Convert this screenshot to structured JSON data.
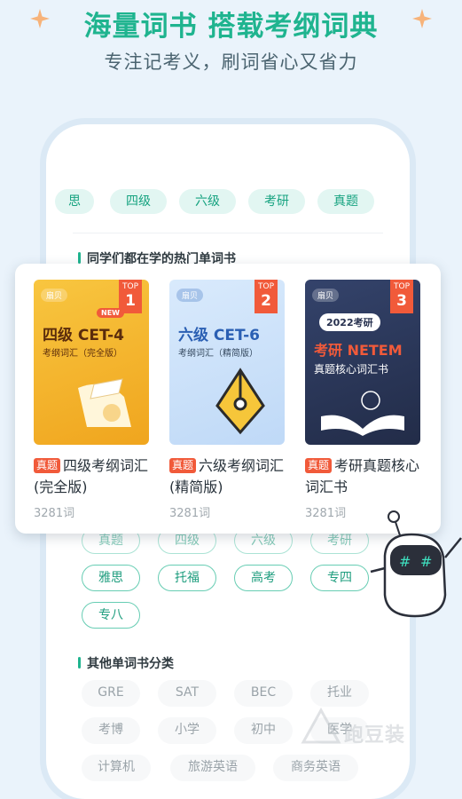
{
  "hero": {
    "title": "海量词书 搭载考纲词典",
    "subtitle": "专注记考义，刷词省心又省力"
  },
  "top_tabs": [
    "思",
    "四级",
    "六级",
    "考研",
    "真题"
  ],
  "section_hot": "同学们都在学的热门单词书",
  "books": [
    {
      "rank_label": "TOP",
      "rank": "1",
      "brand": "扇贝",
      "cover_main": "四级 CET-4",
      "cover_sub": "考纲词汇（完全版）",
      "new_label": "NEW",
      "tag": "真题",
      "title": "四级考纲词汇(完全版)",
      "count": "3281词",
      "cover_color": "#f5b52e"
    },
    {
      "rank_label": "TOP",
      "rank": "2",
      "brand": "扇贝",
      "cover_main": "六级 CET-6",
      "cover_sub": "考纲词汇（精简版）",
      "tag": "真题",
      "title": "六级考纲词汇(精简版)",
      "count": "3281词",
      "cover_color": "#cfe4fb"
    },
    {
      "rank_label": "TOP",
      "rank": "3",
      "brand": "扇贝",
      "cover_year": "2022考研",
      "cover_main": "考研 NETEM",
      "cover_sub": "真题核心词汇书",
      "tag": "真题",
      "title": "考研真题核心词汇书",
      "count": "3281词",
      "cover_color": "#2d3a5c"
    }
  ],
  "exam_pills": [
    "真题",
    "四级",
    "六级",
    "考研",
    "雅思",
    "托福",
    "高考",
    "专四",
    "专八"
  ],
  "section_other": "其他单词书分类",
  "other_pills": [
    "GRE",
    "SAT",
    "BEC",
    "托业",
    "考博",
    "小学",
    "初中",
    "医学",
    "计算机",
    "旅游英语",
    "商务英语"
  ],
  "watermark": "跑豆装",
  "colors": {
    "accent": "#1fb48f",
    "badge": "#f15a3a",
    "background": "#eaf3fb"
  }
}
